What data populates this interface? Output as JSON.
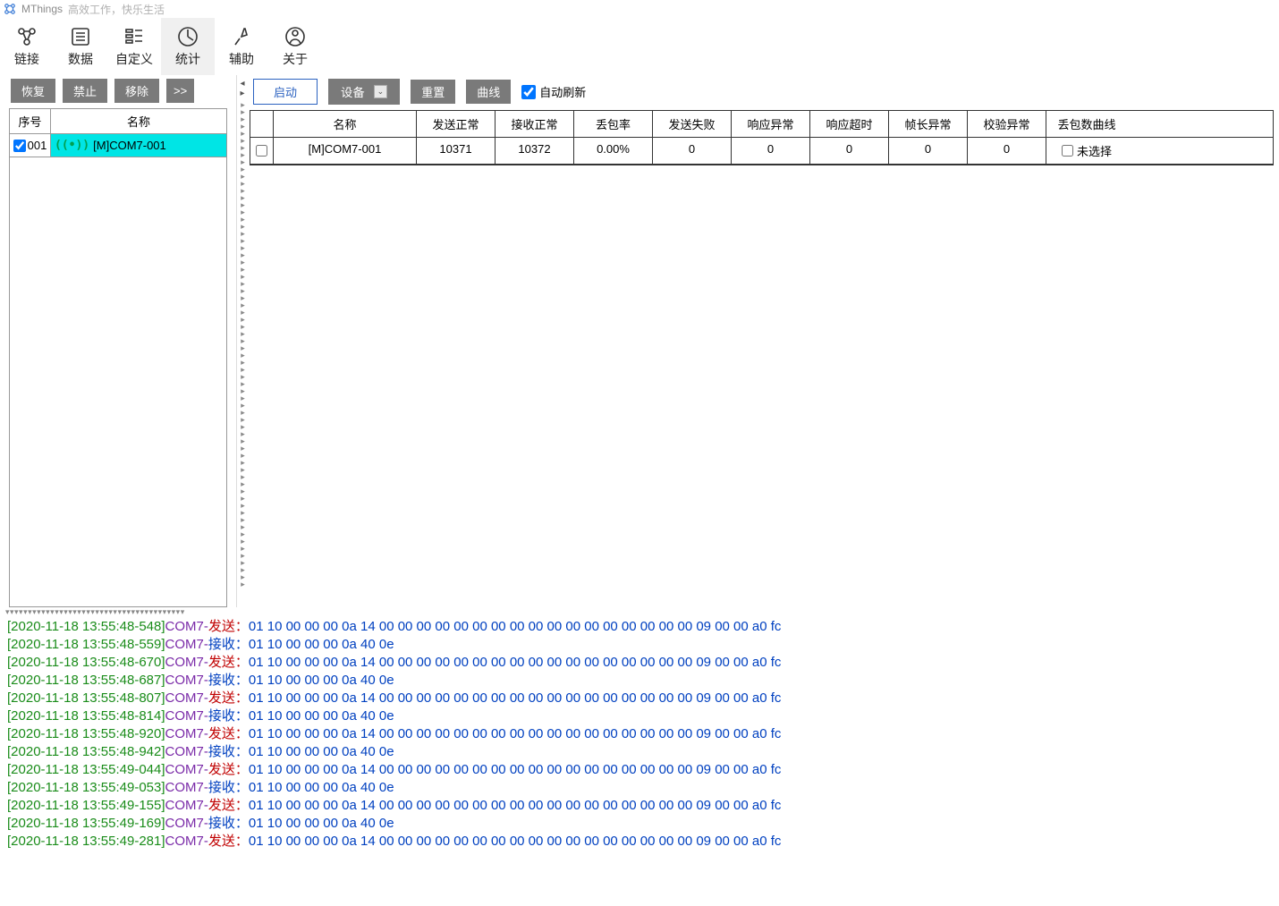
{
  "titlebar": {
    "app": "MThings",
    "slogan": "高效工作，快乐生活"
  },
  "toolbar": {
    "items": [
      {
        "name": "link",
        "label": "链接"
      },
      {
        "name": "data",
        "label": "数据"
      },
      {
        "name": "custom",
        "label": "自定义"
      },
      {
        "name": "stats",
        "label": "统计"
      },
      {
        "name": "assist",
        "label": "辅助"
      },
      {
        "name": "about",
        "label": "关于"
      }
    ]
  },
  "left": {
    "restore": "恢复",
    "forbid": "禁止",
    "remove": "移除",
    "fwd": ">>",
    "hdr_seq": "序号",
    "hdr_name": "名称",
    "rows": [
      {
        "checked": true,
        "seq": "001",
        "name": "[M]COM7-001"
      }
    ]
  },
  "right": {
    "start": "启动",
    "device": "设备",
    "reset": "重置",
    "curve": "曲线",
    "autorefresh": "自动刷新",
    "autorefresh_checked": true,
    "headers": [
      "名称",
      "发送正常",
      "接收正常",
      "丢包率",
      "发送失败",
      "响应异常",
      "响应超时",
      "帧长异常",
      "校验异常",
      "丢包数曲线"
    ],
    "rows": [
      {
        "checked": false,
        "name": "[M]COM7-001",
        "send_ok": "10371",
        "recv_ok": "10372",
        "loss": "0.00%",
        "send_fail": "0",
        "resp_err": "0",
        "resp_to": "0",
        "frame_err": "0",
        "crc_err": "0",
        "curve": "未选择",
        "curve_checked": false
      }
    ]
  },
  "log": [
    {
      "ts": "[2020-11-18 13:55:48-548]",
      "port": "COM7-",
      "dir": "发送：",
      "kind": "send",
      "hex": "01 10 00 00 00 0a 14 00 00 00 00 00 00 00 00 00 00 00 00 00 00 00 00 00 09 00 00 a0 fc"
    },
    {
      "ts": "[2020-11-18 13:55:48-559]",
      "port": "COM7-",
      "dir": "接收：",
      "kind": "recv",
      "hex": "01 10 00 00 00 0a 40 0e"
    },
    {
      "ts": "[2020-11-18 13:55:48-670]",
      "port": "COM7-",
      "dir": "发送：",
      "kind": "send",
      "hex": "01 10 00 00 00 0a 14 00 00 00 00 00 00 00 00 00 00 00 00 00 00 00 00 00 09 00 00 a0 fc"
    },
    {
      "ts": "[2020-11-18 13:55:48-687]",
      "port": "COM7-",
      "dir": "接收：",
      "kind": "recv",
      "hex": "01 10 00 00 00 0a 40 0e"
    },
    {
      "ts": "[2020-11-18 13:55:48-807]",
      "port": "COM7-",
      "dir": "发送：",
      "kind": "send",
      "hex": "01 10 00 00 00 0a 14 00 00 00 00 00 00 00 00 00 00 00 00 00 00 00 00 00 09 00 00 a0 fc"
    },
    {
      "ts": "[2020-11-18 13:55:48-814]",
      "port": "COM7-",
      "dir": "接收：",
      "kind": "recv",
      "hex": "01 10 00 00 00 0a 40 0e"
    },
    {
      "ts": "[2020-11-18 13:55:48-920]",
      "port": "COM7-",
      "dir": "发送：",
      "kind": "send",
      "hex": "01 10 00 00 00 0a 14 00 00 00 00 00 00 00 00 00 00 00 00 00 00 00 00 00 09 00 00 a0 fc"
    },
    {
      "ts": "[2020-11-18 13:55:48-942]",
      "port": "COM7-",
      "dir": "接收：",
      "kind": "recv",
      "hex": "01 10 00 00 00 0a 40 0e"
    },
    {
      "ts": "[2020-11-18 13:55:49-044]",
      "port": "COM7-",
      "dir": "发送：",
      "kind": "send",
      "hex": "01 10 00 00 00 0a 14 00 00 00 00 00 00 00 00 00 00 00 00 00 00 00 00 00 09 00 00 a0 fc"
    },
    {
      "ts": "[2020-11-18 13:55:49-053]",
      "port": "COM7-",
      "dir": "接收：",
      "kind": "recv",
      "hex": "01 10 00 00 00 0a 40 0e"
    },
    {
      "ts": "[2020-11-18 13:55:49-155]",
      "port": "COM7-",
      "dir": "发送：",
      "kind": "send",
      "hex": "01 10 00 00 00 0a 14 00 00 00 00 00 00 00 00 00 00 00 00 00 00 00 00 00 09 00 00 a0 fc"
    },
    {
      "ts": "[2020-11-18 13:55:49-169]",
      "port": "COM7-",
      "dir": "接收：",
      "kind": "recv",
      "hex": "01 10 00 00 00 0a 40 0e"
    },
    {
      "ts": "[2020-11-18 13:55:49-281]",
      "port": "COM7-",
      "dir": "发送：",
      "kind": "send",
      "hex": "01 10 00 00 00 0a 14 00 00 00 00 00 00 00 00 00 00 00 00 00 00 00 00 00 09 00 00 a0 fc"
    }
  ]
}
